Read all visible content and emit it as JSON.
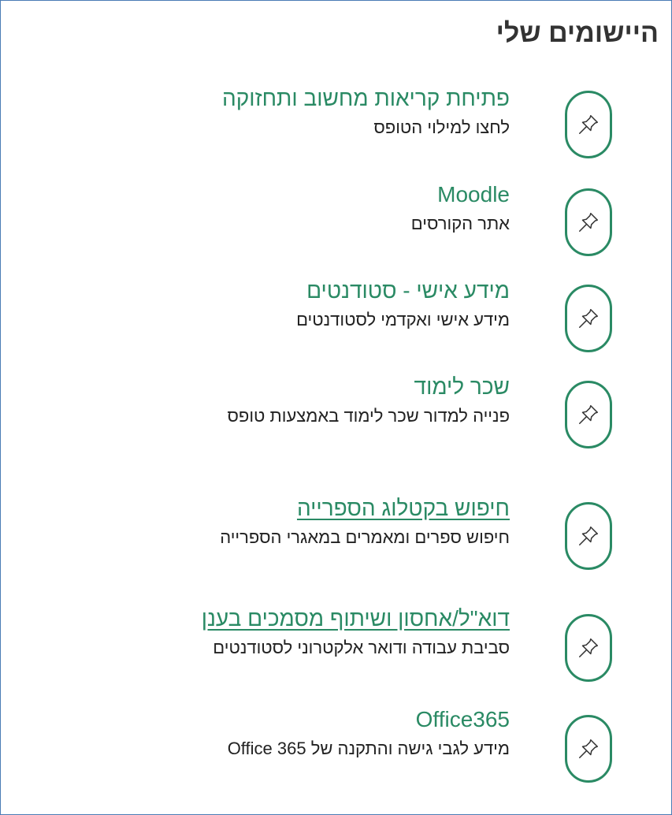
{
  "page": {
    "title": "היישומים שלי"
  },
  "apps": [
    {
      "title": "פתיחת קריאות מחשוב ותחזוקה",
      "description": "לחצו למילוי הטופס",
      "link": false,
      "icon": "pin-icon"
    },
    {
      "title": "Moodle",
      "description": "אתר הקורסים",
      "link": false,
      "icon": "pin-icon"
    },
    {
      "title": "מידע אישי - סטודנטים",
      "description": "מידע אישי ואקדמי לסטודנטים",
      "link": false,
      "icon": "pin-icon"
    },
    {
      "title": "שכר לימוד",
      "description": "פנייה למדור שכר לימוד באמצעות טופס",
      "link": false,
      "icon": "pin-icon"
    },
    {
      "title": "חיפוש בקטלוג הספרייה",
      "description": "חיפוש ספרים ומאמרים במאגרי הספרייה",
      "link": true,
      "icon": "pin-icon"
    },
    {
      "title": "דוא\"ל/אחסון ושיתוף מסמכים בענן",
      "description": "סביבת עבודה ודואר אלקטרוני לסטודנטים",
      "link": true,
      "icon": "pin-icon"
    },
    {
      "title": "Office365",
      "description": "מידע לגבי גישה והתקנה של Office 365",
      "link": false,
      "icon": "pin-icon"
    }
  ],
  "colors": {
    "accent": "#2a8a64",
    "border": "#4a7cb5",
    "heading": "#333333"
  }
}
